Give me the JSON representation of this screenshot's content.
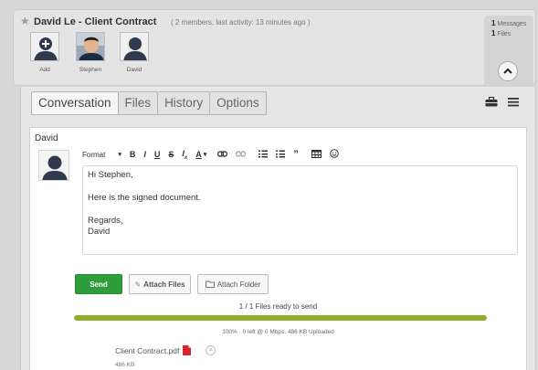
{
  "header": {
    "title": "David Le - Client Contract",
    "meta": "( 2 members, last activity: 13 minutes ago )",
    "members": [
      {
        "label": "Add"
      },
      {
        "label": "Stephen"
      },
      {
        "label": "David"
      }
    ],
    "stats": {
      "messages_count": "1",
      "messages_label": "Messages",
      "files_count": "1",
      "files_label": "Files"
    }
  },
  "tabs": [
    {
      "label": "Conversation",
      "active": true
    },
    {
      "label": "Files"
    },
    {
      "label": "History"
    },
    {
      "label": "Options"
    }
  ],
  "composer": {
    "author": "David",
    "toolbar": {
      "format_label": "Format",
      "icons": [
        "chevron-down-icon",
        "bold-icon",
        "italic-icon",
        "underline-icon",
        "strikethrough-icon",
        "clear-format-icon",
        "font-color-icon",
        "link-icon",
        "unlink-icon",
        "numbered-list-icon",
        "bulleted-list-icon",
        "quote-icon",
        "table-icon",
        "emoji-icon"
      ]
    },
    "body": {
      "greeting": "Hi Stephen,",
      "message": "Here is the signed document.",
      "closing": "Regards,",
      "signature": "David"
    },
    "buttons": {
      "send": "Send",
      "attach_files": "Attach Files",
      "attach_folder": "Attach Folder"
    }
  },
  "upload": {
    "ready_text": "1 / 1 Files ready to send",
    "progress": 1.0,
    "status_text": "100% · 0 left @ 0 Mbps, 486 KB Uploaded",
    "file": {
      "name": "Client Contract.pdf",
      "size": "486 KB"
    }
  },
  "colors": {
    "send": "#2e9e3a",
    "progress": "#8fb12a",
    "pdf_icon": "#d9262c"
  }
}
